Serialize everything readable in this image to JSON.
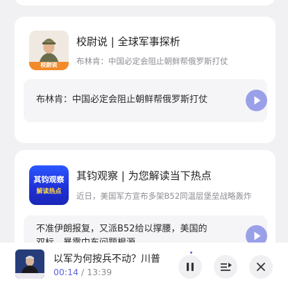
{
  "feed": [
    {
      "title": "校尉说 | 全球军事探析",
      "subtitle": "布林肯：中国必定会阻止朝鲜帮俄罗斯打仗",
      "snippet": "布林肯：中国必定会阻止朝鲜帮俄罗斯打仗",
      "thumb_label": "校尉说",
      "thumb_icon": "soldier-portrait-icon"
    },
    {
      "title": "其钧观察 | 为您解读当下热点",
      "subtitle": "近日，美国军方宣布多架B52同温层堡垒战略轰炸",
      "snippet_line1": "不准伊朗报复，又派B52给以撑腰，美国的",
      "snippet_line2": "双标，暴露中东问题根源",
      "thumb_label_line1": "其钧观察",
      "thumb_label_line2": "解读热点"
    }
  ],
  "player": {
    "title": "以军为何按兵不动？川普",
    "current_time": "00:14",
    "separator": " / ",
    "duration": "13:39",
    "cover_icon": "news-anchor-cover-icon"
  },
  "colors": {
    "accent": "#5b63d8",
    "play_button": "#9aa0e8",
    "background": "#f1f1f4"
  }
}
